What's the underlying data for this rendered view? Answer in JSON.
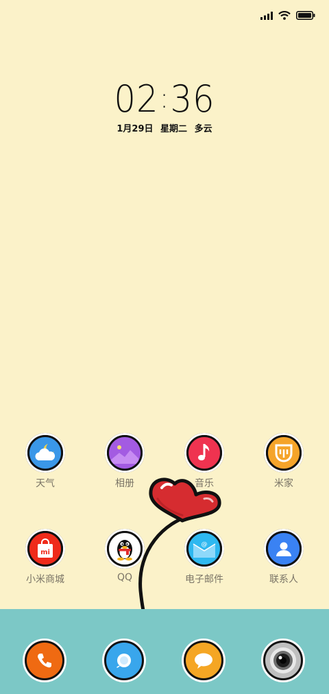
{
  "clock": {
    "hour": "02",
    "minute": "36"
  },
  "date": {
    "day": "1月29日",
    "weekday": "星期二",
    "weather": "多云"
  },
  "apps": [
    {
      "label": "天气",
      "icon": "weather-icon",
      "color": "#3a97e8"
    },
    {
      "label": "相册",
      "icon": "gallery-icon",
      "color": "#a35be2"
    },
    {
      "label": "音乐",
      "icon": "music-icon",
      "color": "#ef3350"
    },
    {
      "label": "米家",
      "icon": "mijia-icon",
      "color": "#f5a42a"
    },
    {
      "label": "小米商城",
      "icon": "mi-store-icon",
      "color": "#ef2b1b"
    },
    {
      "label": "QQ",
      "icon": "qq-penguin-icon",
      "color": "#ffffff"
    },
    {
      "label": "电子邮件",
      "icon": "email-icon",
      "color": "#2eb8f0"
    },
    {
      "label": "联系人",
      "icon": "contacts-icon",
      "color": "#3a82f3"
    }
  ],
  "dock": [
    {
      "icon": "phone-icon",
      "color": "#ef6a12"
    },
    {
      "icon": "browser-icon",
      "color": "#39a6ec"
    },
    {
      "icon": "messages-icon",
      "color": "#f5a624"
    },
    {
      "icon": "camera-icon",
      "color": "#bfbfbf"
    }
  ]
}
